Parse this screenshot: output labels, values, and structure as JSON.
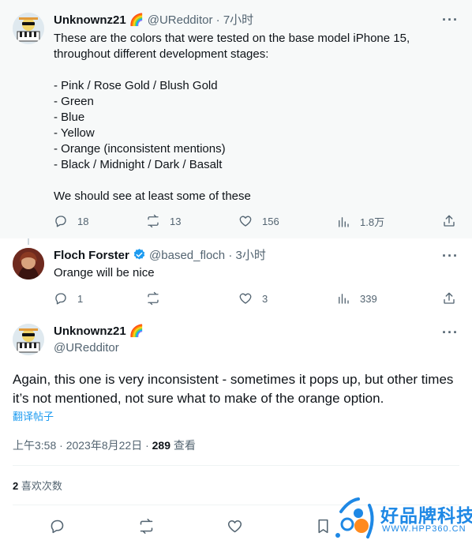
{
  "tweet1": {
    "display_name": "Unknownz21",
    "emoji": "🌈",
    "handle": "@URedditor",
    "time": "· 7小时",
    "text": "These are the colors that were tested on the base model iPhone 15, throughout different development stages:\n\n- Pink / Rose Gold / Blush Gold\n- Green\n- Blue\n- Yellow\n- Orange (inconsistent mentions)\n- Black / Midnight / Dark / Basalt\n\nWe should see at least some of these",
    "replies": "18",
    "retweets": "13",
    "likes": "156",
    "views": "1.8万"
  },
  "tweet2": {
    "display_name": "Floch Forster",
    "handle": "@based_floch",
    "time": "· 3小时",
    "text": "Orange will be nice",
    "replies": "1",
    "retweets": "",
    "likes": "3",
    "views": "339"
  },
  "main": {
    "display_name": "Unknownz21",
    "emoji": "🌈",
    "handle": "@URedditor",
    "text": "Again, this one is very inconsistent - sometimes it pops up, but other times it’s not mentioned, not sure what to make of the orange option.",
    "translate": "翻译帖子",
    "timestamp": "上午3:58 · 2023年8月22日 · ",
    "view_count": "289",
    "view_label": " 查看",
    "like_count": "2",
    "like_label": " 喜欢次数"
  },
  "watermark": {
    "title": "好品牌科技网",
    "url": "WWW.HPP360.CN"
  },
  "colors": {
    "accent": "#1d9bf0",
    "text": "#0f1419",
    "muted": "#536471",
    "divider": "#eff3f4",
    "watermark": "#1e88e5"
  }
}
